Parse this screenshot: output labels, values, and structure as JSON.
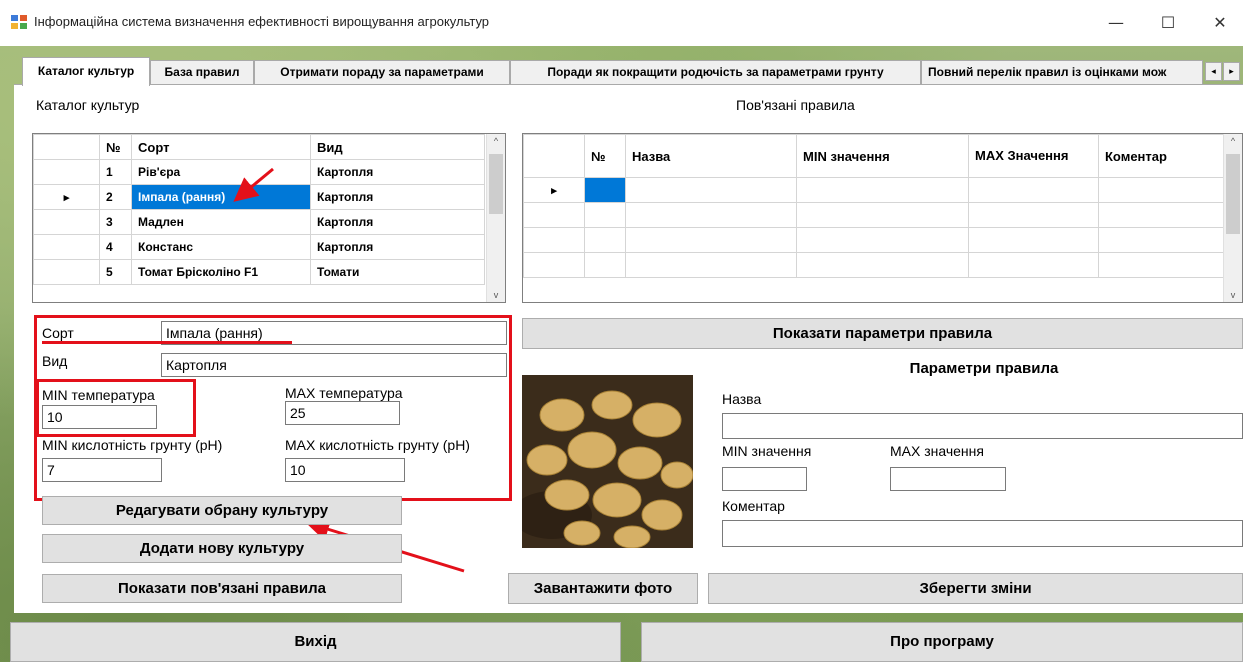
{
  "window": {
    "title": "Інформаційна система визначення ефективності вирощування агрокультур",
    "minimize": "—",
    "maximize": "☐",
    "close": "✕"
  },
  "tabs": [
    {
      "label": "Каталог культур"
    },
    {
      "label": "База правил"
    },
    {
      "label": "Отримати пораду за параметрами"
    },
    {
      "label": "Поради як покращити родючість за параметрами грунту"
    },
    {
      "label": "Повний перелік правил із оцінками мож"
    }
  ],
  "tab_scroll": {
    "left": "◂",
    "right": "▸"
  },
  "catalog": {
    "title": "Каталог культур",
    "columns": [
      "№",
      "Сорт",
      "Вид"
    ],
    "rows": [
      {
        "no": "1",
        "sort": "Рів'єра",
        "kind": "Картопля"
      },
      {
        "no": "2",
        "sort": "Імпала (рання)",
        "kind": "Картопля"
      },
      {
        "no": "3",
        "sort": "Мадлен",
        "kind": "Картопля"
      },
      {
        "no": "4",
        "sort": "Констанс",
        "kind": "Картопля"
      },
      {
        "no": "5",
        "sort": "Томат Брісколіно F1",
        "kind": "Томати"
      }
    ]
  },
  "rules": {
    "title": "Пов'язані правила",
    "columns": [
      "№",
      "Назва",
      "MIN значення",
      "MAX Значення",
      "Коментар"
    ]
  },
  "scroll": {
    "up": "^",
    "down": "v"
  },
  "row_marker": "▸",
  "form": {
    "sort_label": "Сорт",
    "sort_value": "Імпала (рання)",
    "kind_label": "Вид",
    "kind_value": "Картопля",
    "min_temp_label": "MIN температура",
    "min_temp_value": "10",
    "max_temp_label": "MAX температура",
    "max_temp_value": "25",
    "min_ph_label": "MIN кислотність грунту (pH)",
    "min_ph_value": "7",
    "max_ph_label": "MAX кислотність грунту (pH)",
    "max_ph_value": "10"
  },
  "buttons": {
    "edit": "Редагувати обрану культуру",
    "add": "Додати нову культуру",
    "show_rules": "Показати пов'язані правила",
    "load_photo": "Завантажити фото",
    "show_params": "Показати параметри правила",
    "save": "Зберегти зміни",
    "exit": "Вихід",
    "about": "Про програму"
  },
  "rule_params": {
    "title": "Параметри правила",
    "name_label": "Назва",
    "min_label": "MIN значення",
    "max_label": "MAX значення",
    "comment_label": "Коментар"
  }
}
